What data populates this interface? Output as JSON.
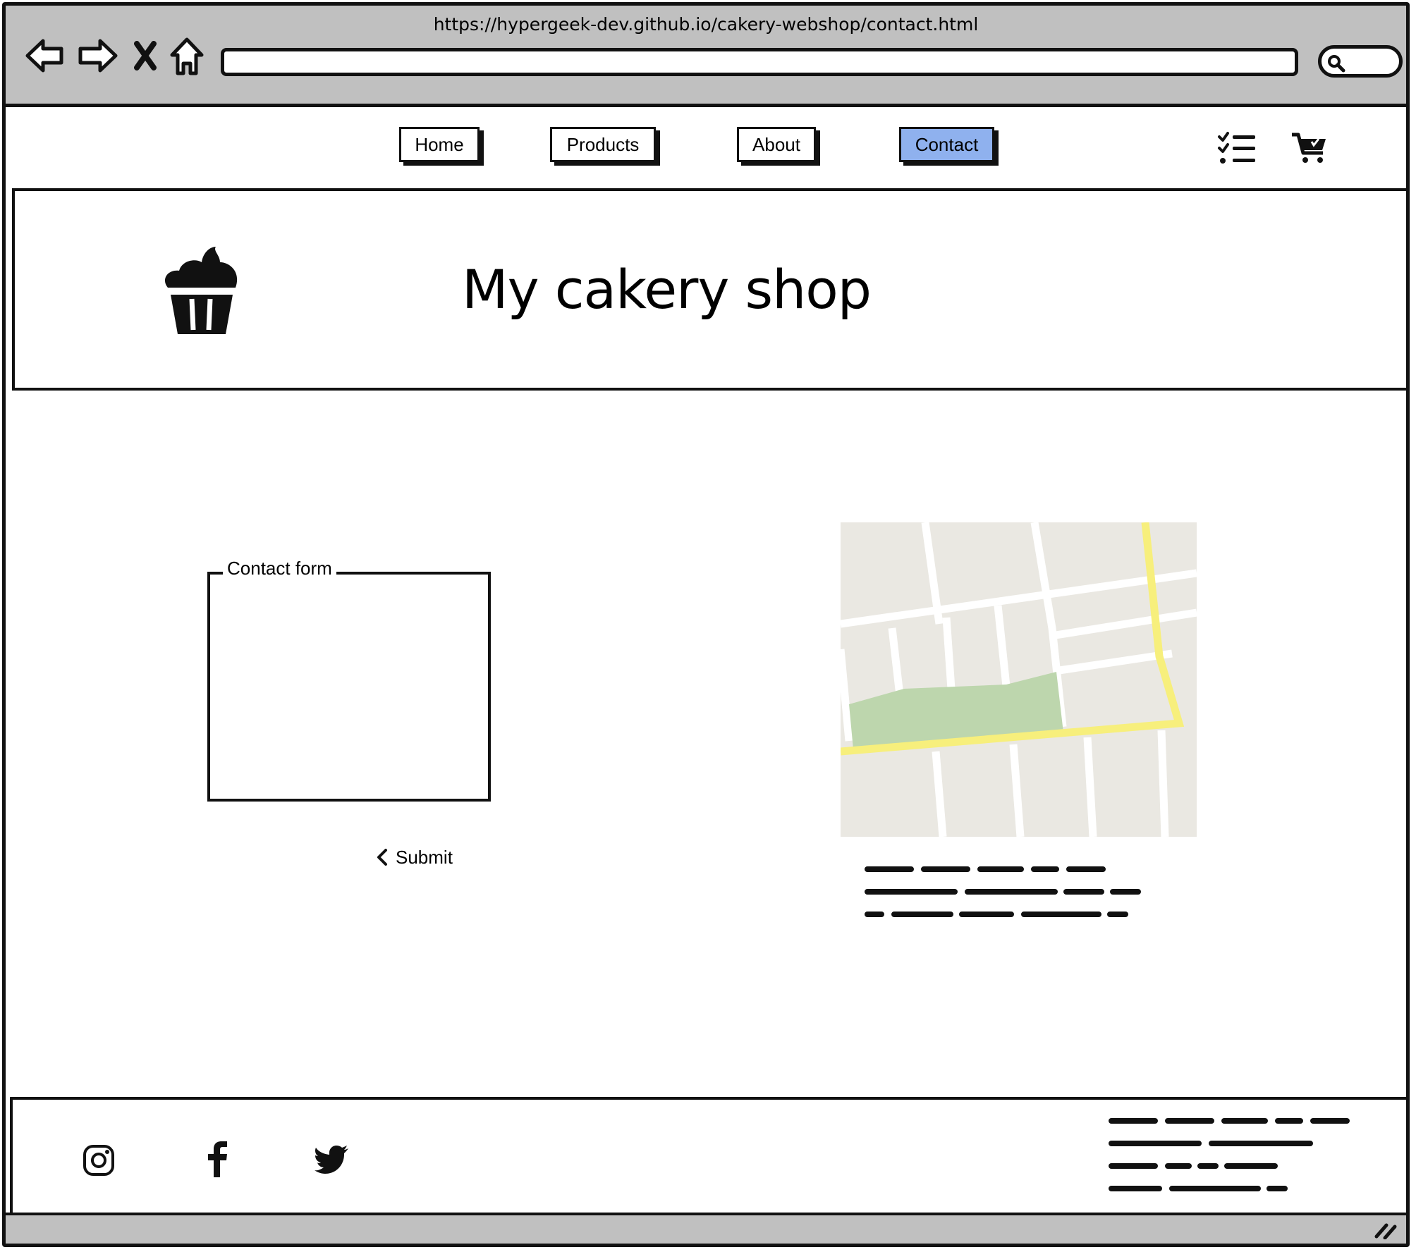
{
  "browser": {
    "url": "https://hypergeek-dev.github.io/cakery-webshop/contact.html",
    "address_value": "",
    "search_value": ""
  },
  "nav": {
    "items": [
      {
        "label": "Home",
        "active": false
      },
      {
        "label": "Products",
        "active": false
      },
      {
        "label": "About",
        "active": false
      },
      {
        "label": "Contact",
        "active": true
      }
    ],
    "icons": [
      "checklist-icon",
      "shopping-cart-icon"
    ],
    "active_color": "#8fb1ee"
  },
  "banner": {
    "title": "My cakery shop",
    "logo": "cupcake-icon"
  },
  "contact": {
    "legend": "Contact form",
    "submit_label": "Submit",
    "submit_icon": "chevron-left-icon"
  },
  "map": {
    "icon": "map",
    "colors": {
      "land": "#eae8e2",
      "road": "#ffffff",
      "highway": "#f7ef7c",
      "park": "#bdd6ad"
    }
  },
  "footer": {
    "social": [
      "instagram-icon",
      "facebook-icon",
      "twitter-icon"
    ]
  },
  "colors": {
    "chrome": "#c0c0c0",
    "outline": "#111111"
  }
}
